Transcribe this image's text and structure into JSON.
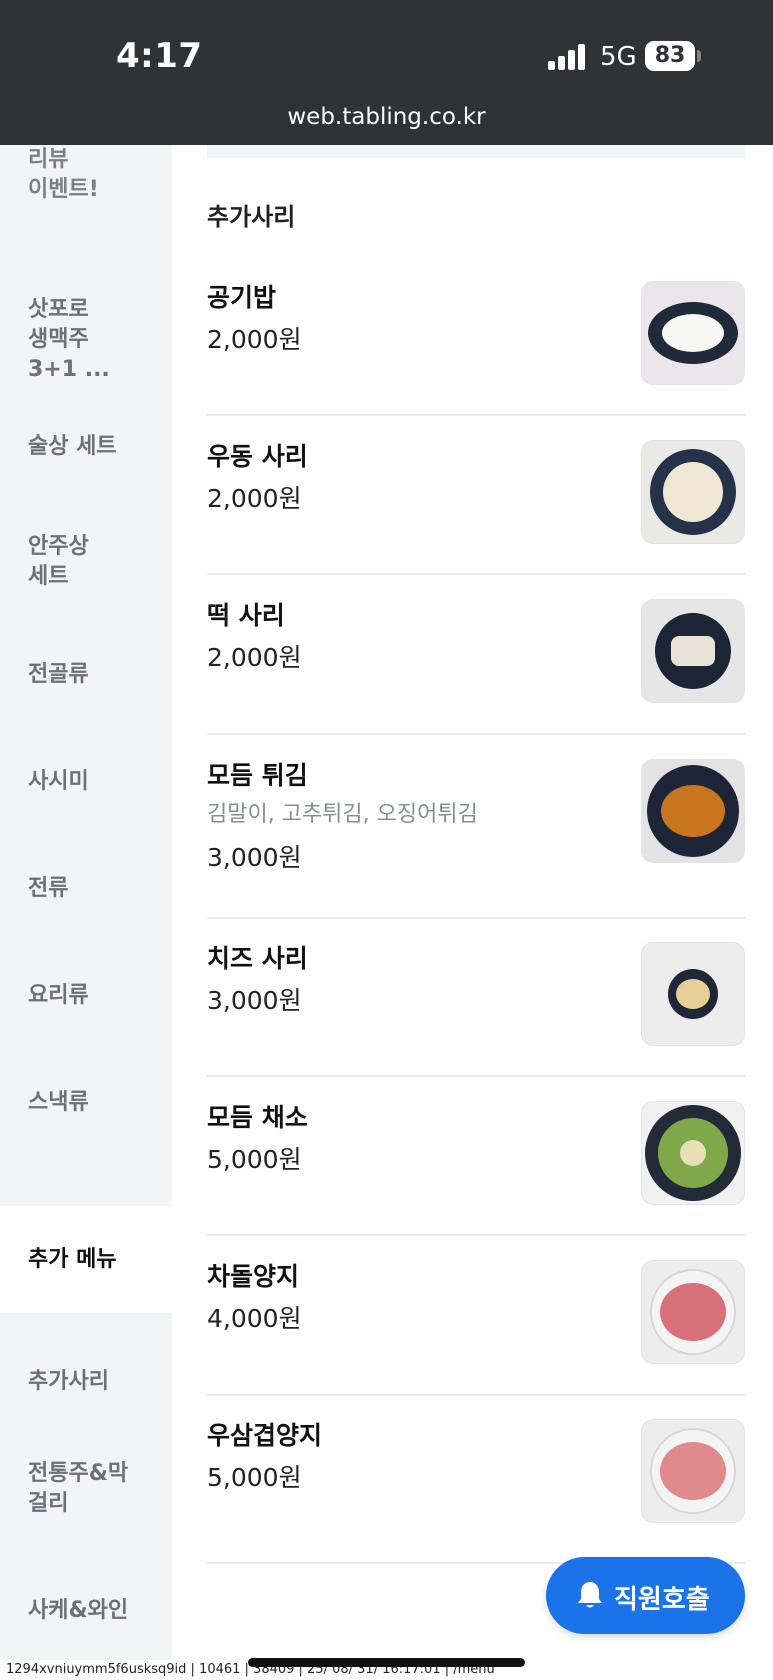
{
  "status_bar": {
    "time": "4:17",
    "network": "5G",
    "battery": "83",
    "url": "web.tabling.co.kr"
  },
  "sidebar": {
    "items": [
      {
        "label": "리뷰\n이벤트!",
        "active": false
      },
      {
        "label": "삿포로\n생맥주\n3+1 ...",
        "active": false
      },
      {
        "label": "술상 세트",
        "active": false
      },
      {
        "label": "안주상\n세트",
        "active": false
      },
      {
        "label": "전골류",
        "active": false
      },
      {
        "label": "사시미",
        "active": false
      },
      {
        "label": "전류",
        "active": false
      },
      {
        "label": "요리류",
        "active": false
      },
      {
        "label": "스낵류",
        "active": false
      },
      {
        "label": "추가 메뉴",
        "active": true
      },
      {
        "label": "추가사리",
        "active": false
      },
      {
        "label": "전통주&막\n걸리",
        "active": false
      },
      {
        "label": "사케&와인",
        "active": false
      }
    ]
  },
  "main": {
    "section_title": "추가사리",
    "items": [
      {
        "name": "공기밥",
        "desc": "",
        "price": "2,000원"
      },
      {
        "name": "우동 사리",
        "desc": "",
        "price": "2,000원"
      },
      {
        "name": "떡 사리",
        "desc": "",
        "price": "2,000원"
      },
      {
        "name": "모듬 튀김",
        "desc": "김말이, 고추튀김, 오징어튀김",
        "price": "3,000원"
      },
      {
        "name": "치즈 사리",
        "desc": "",
        "price": "3,000원"
      },
      {
        "name": "모듬 채소",
        "desc": "",
        "price": "5,000원"
      },
      {
        "name": "차돌양지",
        "desc": "",
        "price": "4,000원"
      },
      {
        "name": "우삼겹양지",
        "desc": "",
        "price": "5,000원"
      }
    ]
  },
  "call_button": {
    "label": "직원호출"
  },
  "footer": {
    "text": "1294xvniuymm5f6usksq9id | 10461 | 38409 | 25/ 08/ 31/ 16:17:01 | /menu"
  },
  "colors": {
    "accent": "#1a73e8",
    "sidebar_bg": "#f2f4f7",
    "status_bg": "#2f3236"
  },
  "icons": {
    "bell": "bell-icon",
    "signal": "signal-icon"
  }
}
